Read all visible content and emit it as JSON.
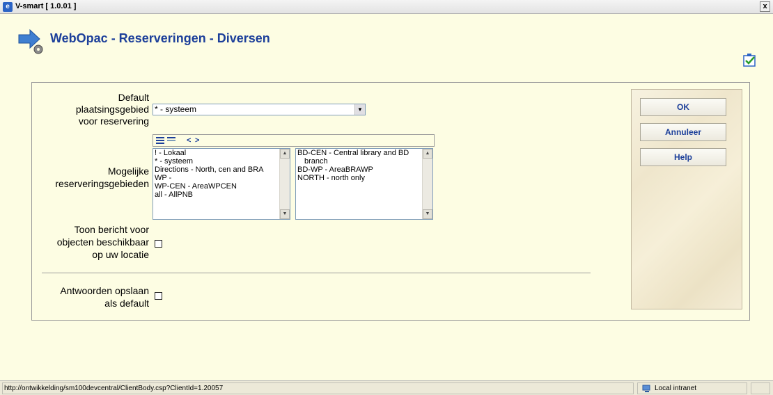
{
  "window": {
    "title": "V-smart [ 1.0.01 ]",
    "close_label": "x"
  },
  "page": {
    "title": "WebOpac - Reserveringen - Diversen"
  },
  "form": {
    "default_area_label_1": "Default",
    "default_area_label_2": "plaatsingsgebied",
    "default_area_label_3": "voor reservering",
    "default_area_value": "* - systeem",
    "possible_areas_label_1": "Mogelijke",
    "possible_areas_label_2": "reserveringsgebieden",
    "available_list": [
      "! - Lokaal",
      "* - systeem",
      "Directions - North, cen and BRA",
      "WP -",
      "WP-CEN - AreaWPCEN",
      "all - AllPNB"
    ],
    "selected_list": [
      "BD-CEN - Central library and BD",
      "branch",
      "BD-WP - AreaBRAWP",
      "NORTH - north only"
    ],
    "show_message_label_1": "Toon bericht voor",
    "show_message_label_2": "objecten beschikbaar",
    "show_message_label_3": "op uw locatie",
    "save_answers_label_1": "Antwoorden opslaan",
    "save_answers_label_2": "als default"
  },
  "buttons": {
    "ok": "OK",
    "cancel": "Annuleer",
    "help": "Help"
  },
  "toolbar": {
    "prev": "<",
    "next": ">"
  },
  "status": {
    "url": "http://ontwikkelding/sm100devcentral/ClientBody.csp?ClientId=1.20057",
    "zone": "Local intranet"
  }
}
